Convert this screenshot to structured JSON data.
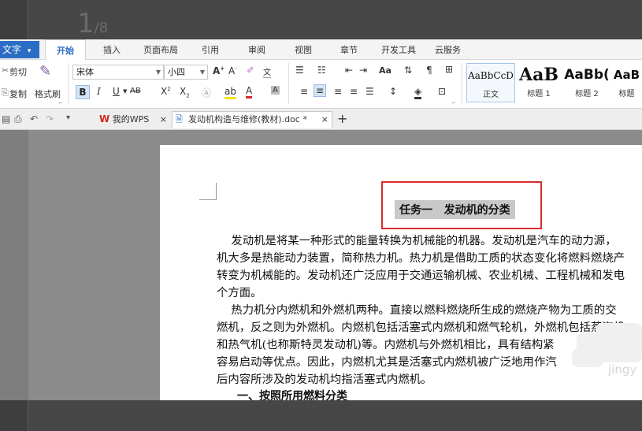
{
  "step": {
    "current": "1",
    "total": "/8"
  },
  "app_menu": {
    "label": "文字",
    "arrow": "▾"
  },
  "menu_tabs": [
    "开始",
    "插入",
    "页面布局",
    "引用",
    "审阅",
    "视图",
    "章节",
    "开发工具",
    "云服务"
  ],
  "ribbon": {
    "cut": "剪切",
    "copy": "复制",
    "format_painter": "格式刷",
    "font_name": "宋体",
    "font_size": "小四",
    "pinyin": "文",
    "change_case": "Aa"
  },
  "styles": [
    {
      "sample": "AaBbCcD",
      "name": "正文"
    },
    {
      "sample": "AaB",
      "name": "标题 1"
    },
    {
      "sample": "AaBb(",
      "name": "标题 2"
    },
    {
      "sample": "AaB",
      "name": "标题"
    }
  ],
  "tabs": {
    "wps": "我的WPS",
    "doc": "发动机构造与维修(教材).doc *",
    "close": "×",
    "add": "+"
  },
  "document": {
    "title": "任务一   发动机的分类",
    "paragraphs": [
      "    发动机是将某一种形式的能量转换为机械能的机器。发动机是汽车的动力源，",
      "机大多是热能动力装置，简称热力机。热力机是借助工质的状态变化将燃料燃烧产",
      "转变为机械能的。发动机还广泛应用于交通运输机械、农业机械、工程机械和发电",
      "个方面。",
      "    热力机分内燃机和外燃机两种。直接以燃料燃烧所生成的燃烧产物为工质的交",
      "燃机，反之则为外燃机。内燃机包括活塞式内燃机和燃气轮机，外燃机包括蒸汽机",
      "和热气机(也称斯特灵发动机)等。内燃机与外燃机相比，具有结构紧",
      "容易启动等优点。因此，内燃机尤其是活塞式内燃机被广泛地用作汽",
      "后内容所涉及的发动机均指活塞式内燃机。"
    ],
    "heading2": "一、按照所用燃料分类"
  },
  "watermark": "jingy",
  "colors": {
    "accent": "#2b6cc4",
    "highlight_box": "#d92b2b",
    "wps_red": "#d3281c"
  }
}
